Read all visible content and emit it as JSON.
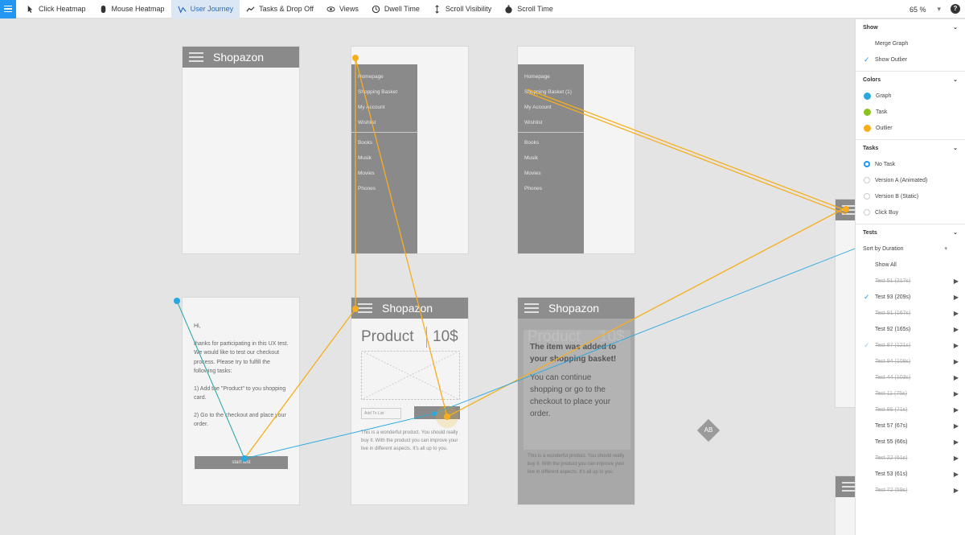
{
  "toolbar": {
    "tools": [
      {
        "label": "Click Heatmap",
        "icon": "pointer-icon",
        "active": false
      },
      {
        "label": "Mouse Heatmap",
        "icon": "mouse-icon",
        "active": false
      },
      {
        "label": "User Journey",
        "icon": "journey-icon",
        "active": true
      },
      {
        "label": "Tasks & Drop Off",
        "icon": "trend-icon",
        "active": false
      },
      {
        "label": "Views",
        "icon": "eye-icon",
        "active": false
      },
      {
        "label": "Dwell Time",
        "icon": "clock-icon",
        "active": false
      },
      {
        "label": "Scroll Visibility",
        "icon": "scroll-icon",
        "active": false
      },
      {
        "label": "Scroll Time",
        "icon": "timer-icon",
        "active": false
      }
    ],
    "zoom": "65 %"
  },
  "screens": {
    "app_title": "Shopazon",
    "drawer_items_1": [
      "Homepage",
      "Shopping Basket",
      "My Account",
      "Wishlist"
    ],
    "drawer_items_2": [
      "Books",
      "Musik",
      "Movies",
      "Phones"
    ],
    "drawer3_items_1": [
      "Homepage",
      "Shopping Basket (1)",
      "My Account",
      "Wishlist"
    ],
    "intro": {
      "hi": "Hi,",
      "p1": "thanks for participating in this UX test. We would like to test our checkout process. Please try to fulfill the following tasks:",
      "t1": "1) Add the \"Product\" to you shopping card.",
      "t2": "2) Go to the checkout and place your order.",
      "start": "start test"
    },
    "product": {
      "title": "Product",
      "price": "10$",
      "add_to_list": "Add To List",
      "desc": "This is a wonderful product. You should really buy it. With the product you can improve your live in different aspects. It's all up to you."
    },
    "modal": {
      "heading": "The item was added to your shopping basket!",
      "body": "You can continue shopping or go to the checkout to place your order."
    },
    "ab_badge": "AB"
  },
  "sidebar": {
    "show_title": "Show",
    "show_items": [
      {
        "label": "Merge Graph",
        "checked": false
      },
      {
        "label": "Show Outlier",
        "checked": true
      }
    ],
    "colors_title": "Colors",
    "colors": [
      {
        "label": "Graph",
        "color": "#29a8e0"
      },
      {
        "label": "Task",
        "color": "#8cc21d"
      },
      {
        "label": "Outlier",
        "color": "#f6ae1d"
      }
    ],
    "tasks_title": "Tasks",
    "tasks": [
      {
        "label": "No Task",
        "on": true
      },
      {
        "label": "Version A (Animated)",
        "on": false
      },
      {
        "label": "Version B (Static)",
        "on": false
      },
      {
        "label": "Click Buy",
        "on": false
      }
    ],
    "tests_title": "Tests",
    "sort_label": "Sort by Duration",
    "show_all": "Show All",
    "tests": [
      {
        "label": "Test 51 (217s)",
        "state": "strike"
      },
      {
        "label": "Test 93 (209s)",
        "state": "checked"
      },
      {
        "label": "Test 91 (167s)",
        "state": "strike"
      },
      {
        "label": "Test 92 (165s)",
        "state": "normal"
      },
      {
        "label": "Test 87 (121s)",
        "state": "checkstrike"
      },
      {
        "label": "Test 94 (108s)",
        "state": "strike"
      },
      {
        "label": "Test 44 (103s)",
        "state": "strike"
      },
      {
        "label": "Test 11 (75s)",
        "state": "strike"
      },
      {
        "label": "Test 86 (71s)",
        "state": "strike"
      },
      {
        "label": "Test 57 (67s)",
        "state": "normal"
      },
      {
        "label": "Test 55 (66s)",
        "state": "normal"
      },
      {
        "label": "Test 22 (61s)",
        "state": "strike"
      },
      {
        "label": "Test 53 (61s)",
        "state": "normal"
      },
      {
        "label": "Test 72 (59s)",
        "state": "strike"
      }
    ]
  }
}
